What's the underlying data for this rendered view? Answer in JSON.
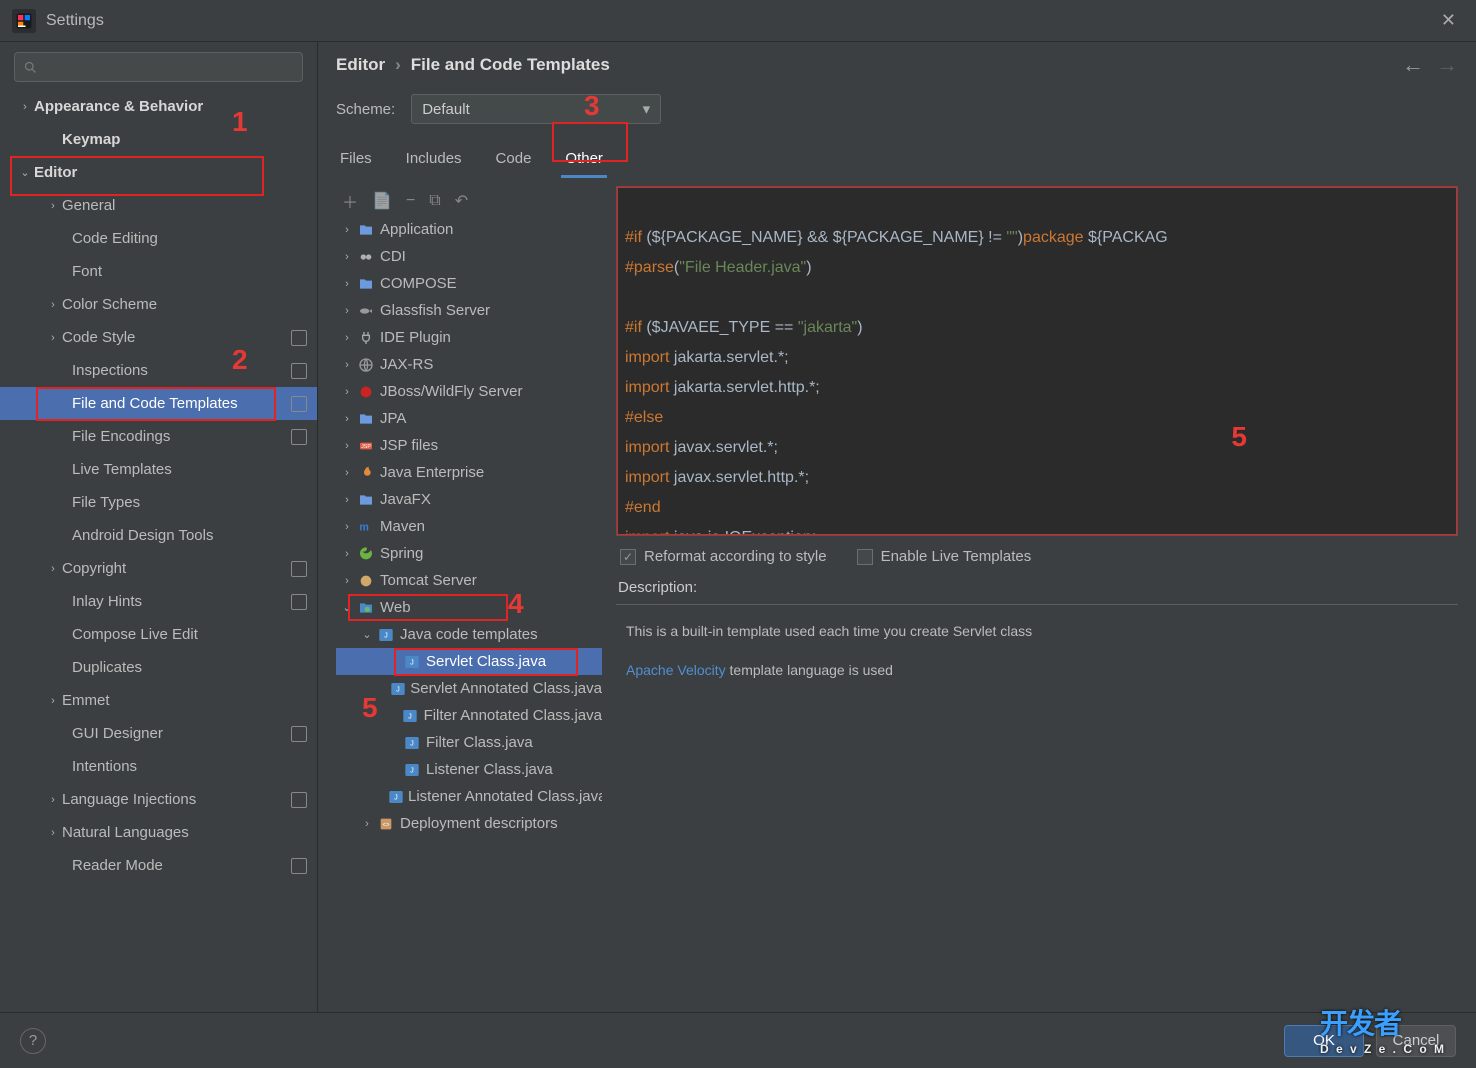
{
  "window": {
    "title": "Settings"
  },
  "search": {
    "placeholder": ""
  },
  "nav": [
    {
      "label": "Appearance & Behavior",
      "depth": 1,
      "chev": "›",
      "bold": true
    },
    {
      "label": "Keymap",
      "depth": 2,
      "bold": true
    },
    {
      "label": "Editor",
      "depth": 1,
      "chev": "⌄",
      "bold": true,
      "selected": false,
      "anno": true
    },
    {
      "label": "General",
      "depth": 2,
      "chev": "›"
    },
    {
      "label": "Code Editing",
      "depth": 3
    },
    {
      "label": "Font",
      "depth": 3
    },
    {
      "label": "Color Scheme",
      "depth": 2,
      "chev": "›"
    },
    {
      "label": "Code Style",
      "depth": 2,
      "chev": "›",
      "badge": true
    },
    {
      "label": "Inspections",
      "depth": 3,
      "badge": true
    },
    {
      "label": "File and Code Templates",
      "depth": 3,
      "selected": true,
      "badge": true,
      "anno2": true
    },
    {
      "label": "File Encodings",
      "depth": 3,
      "badge": true
    },
    {
      "label": "Live Templates",
      "depth": 3
    },
    {
      "label": "File Types",
      "depth": 3
    },
    {
      "label": "Android Design Tools",
      "depth": 3
    },
    {
      "label": "Copyright",
      "depth": 2,
      "chev": "›",
      "badge": true
    },
    {
      "label": "Inlay Hints",
      "depth": 3,
      "badge": true
    },
    {
      "label": "Compose Live Edit",
      "depth": 3
    },
    {
      "label": "Duplicates",
      "depth": 3
    },
    {
      "label": "Emmet",
      "depth": 2,
      "chev": "›"
    },
    {
      "label": "GUI Designer",
      "depth": 3,
      "badge": true
    },
    {
      "label": "Intentions",
      "depth": 3
    },
    {
      "label": "Language Injections",
      "depth": 2,
      "chev": "›",
      "badge": true
    },
    {
      "label": "Natural Languages",
      "depth": 2,
      "chev": "›"
    },
    {
      "label": "Reader Mode",
      "depth": 3,
      "badge": true
    }
  ],
  "breadcrumb": {
    "a": "Editor",
    "b": "File and Code Templates"
  },
  "scheme": {
    "label": "Scheme:",
    "value": "Default"
  },
  "tabs": [
    "Files",
    "Includes",
    "Code",
    "Other"
  ],
  "activeTab": 3,
  "tpl": [
    {
      "label": "Application",
      "depth": 0,
      "chev": "›",
      "ic": "folder"
    },
    {
      "label": "CDI",
      "depth": 0,
      "chev": "›",
      "ic": "cdi"
    },
    {
      "label": "COMPOSE",
      "depth": 0,
      "chev": "›",
      "ic": "folder"
    },
    {
      "label": "Glassfish Server",
      "depth": 0,
      "chev": "›",
      "ic": "fish"
    },
    {
      "label": "IDE Plugin",
      "depth": 0,
      "chev": "›",
      "ic": "plug"
    },
    {
      "label": "JAX-RS",
      "depth": 0,
      "chev": "›",
      "ic": "globe"
    },
    {
      "label": "JBoss/WildFly Server",
      "depth": 0,
      "chev": "›",
      "ic": "jboss"
    },
    {
      "label": "JPA",
      "depth": 0,
      "chev": "›",
      "ic": "folder"
    },
    {
      "label": "JSP files",
      "depth": 0,
      "chev": "›",
      "ic": "jsp"
    },
    {
      "label": "Java Enterprise",
      "depth": 0,
      "chev": "›",
      "ic": "flame"
    },
    {
      "label": "JavaFX",
      "depth": 0,
      "chev": "›",
      "ic": "folder"
    },
    {
      "label": "Maven",
      "depth": 0,
      "chev": "›",
      "ic": "maven"
    },
    {
      "label": "Spring",
      "depth": 0,
      "chev": "›",
      "ic": "spring"
    },
    {
      "label": "Tomcat Server",
      "depth": 0,
      "chev": "›",
      "ic": "tomcat"
    },
    {
      "label": "Web",
      "depth": 0,
      "chev": "⌄",
      "ic": "web",
      "anno4": true
    },
    {
      "label": "Java code templates",
      "depth": 1,
      "chev": "⌄",
      "ic": "java"
    },
    {
      "label": "Servlet Class.java",
      "depth": 2,
      "ic": "java",
      "selected": true,
      "anno5row": true
    },
    {
      "label": "Servlet Annotated Class.java",
      "depth": 2,
      "ic": "java"
    },
    {
      "label": "Filter Annotated Class.java",
      "depth": 2,
      "ic": "java"
    },
    {
      "label": "Filter Class.java",
      "depth": 2,
      "ic": "java"
    },
    {
      "label": "Listener Class.java",
      "depth": 2,
      "ic": "java"
    },
    {
      "label": "Listener Annotated Class.java",
      "depth": 2,
      "ic": "java"
    },
    {
      "label": "Deployment descriptors",
      "depth": 1,
      "chev": "›",
      "ic": "dd"
    }
  ],
  "code": {
    "l1a": "#if",
    "l1b": " (${PACKAGE_NAME} && ${PACKAGE_NAME} != ",
    "l1c": "\"\"",
    "l1d": ")",
    "l1e": "package",
    "l1f": " ${PACKAG",
    "l2a": "#parse",
    "l2b": "(",
    "l2c": "\"File Header.java\"",
    "l2d": ")",
    "l3": "",
    "l4a": "#if",
    "l4b": " ($JAVAEE_TYPE == ",
    "l4c": "\"jakarta\"",
    "l4d": ")",
    "l5a": "import",
    "l5b": " jakarta.servlet.*;",
    "l6a": "import",
    "l6b": " jakarta.servlet.http.*;",
    "l7": "#else",
    "l8a": "import",
    "l8b": " javax.servlet.*;",
    "l9a": "import",
    "l9b": " javax.servlet.http.*;",
    "l10": "#end",
    "l11a": "import",
    "l11b": " java.io.IOException;"
  },
  "opts": {
    "reformat": "Reformat according to style",
    "live": "Enable Live Templates"
  },
  "desc": {
    "label": "Description:",
    "line1": "This is a built-in template used each time you create Servlet class",
    "link": "Apache Velocity",
    "line2": " template language is used"
  },
  "footer": {
    "ok": "OK",
    "cancel": "Cancel"
  },
  "anno": {
    "n1": "1",
    "n2": "2",
    "n3": "3",
    "n4": "4",
    "n5": "5",
    "n5b": "5"
  }
}
